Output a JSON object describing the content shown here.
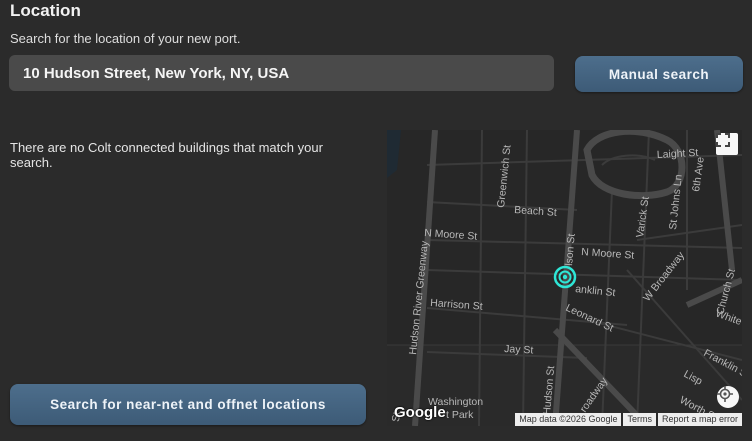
{
  "header": {
    "title": "Location",
    "subtitle": "Search for the location of your new port."
  },
  "search": {
    "value": "10 Hudson Street, New York, NY, USA"
  },
  "buttons": {
    "manual_search": "Manual search",
    "near_net": "Search for near-net and offnet locations"
  },
  "results": {
    "message": "There are no Colt connected buildings that match your search."
  },
  "map": {
    "streets": {
      "hudson_river_greenway": "Hudson River Greenway",
      "greenwich_st": "Greenwich St",
      "beach_st": "Beach St",
      "n_moore_st_west": "N Moore St",
      "n_moore_st_east": "N Moore St",
      "hudson_st_top": "lson St",
      "hudson_st_bottom": "Hudson St",
      "varick_st": "Varick St",
      "st_johns_ln": "St Johns Ln",
      "laight_st": "Laight St",
      "sixth_ave": "6th Ave",
      "franklin_st": "anklin St",
      "franklin_st_east": "Franklin St",
      "w_broadway": "W Broadway",
      "church_st": "Church St",
      "white_st": "White",
      "harrison_st": "Harrison St",
      "leonard_st": "Leonard St",
      "jay_st": "Jay St",
      "broadway": "roadway",
      "worth_st": "Worth S",
      "lispenard": "Lisp",
      "washington_park_1": "Washington",
      "washington_park_2": "t Park",
      "left_edge_st": "St"
    },
    "google_logo": "Google",
    "attribution": {
      "map_data": "Map data ©2026 Google",
      "terms": "Terms",
      "report": "Report a map error"
    },
    "marker_color": "#2ee6d6"
  }
}
